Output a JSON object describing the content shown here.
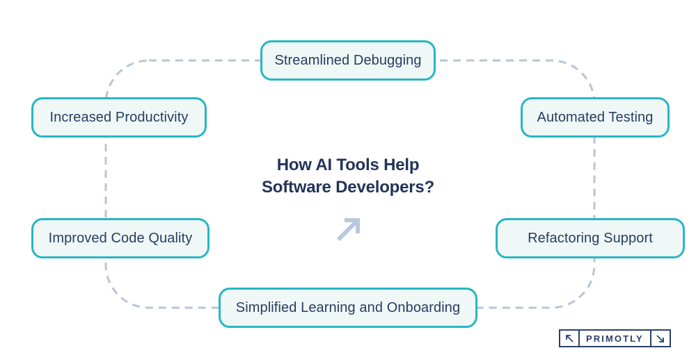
{
  "diagram": {
    "center": {
      "title": "How AI Tools Help\nSoftware Developers?",
      "arrow_icon": "arrow-up-right-icon"
    },
    "nodes": [
      {
        "id": "streamlined-debugging",
        "label": "Streamlined Debugging"
      },
      {
        "id": "increased-productivity",
        "label": "Increased Productivity"
      },
      {
        "id": "automated-testing",
        "label": "Automated Testing"
      },
      {
        "id": "improved-code-quality",
        "label": "Improved Code Quality"
      },
      {
        "id": "refactoring-support",
        "label": "Refactoring Support"
      },
      {
        "id": "simplified-learning-and-onboarding",
        "label": "Simplified Learning and Onboarding"
      }
    ],
    "colors": {
      "pill_border": "#27b6c4",
      "pill_fill": "#eff8f7",
      "text_navy": "#273c5f",
      "title_navy": "#22335a",
      "dashed_line": "#bac4d6",
      "arrow_icon": "#b9c8e1",
      "logo_navy": "#2b4069",
      "background": "#ffffff"
    }
  },
  "logo": {
    "wordmark": "PRIMOTLY",
    "left_icon": "arrow-up-left-icon",
    "right_icon": "arrow-down-right-icon"
  }
}
